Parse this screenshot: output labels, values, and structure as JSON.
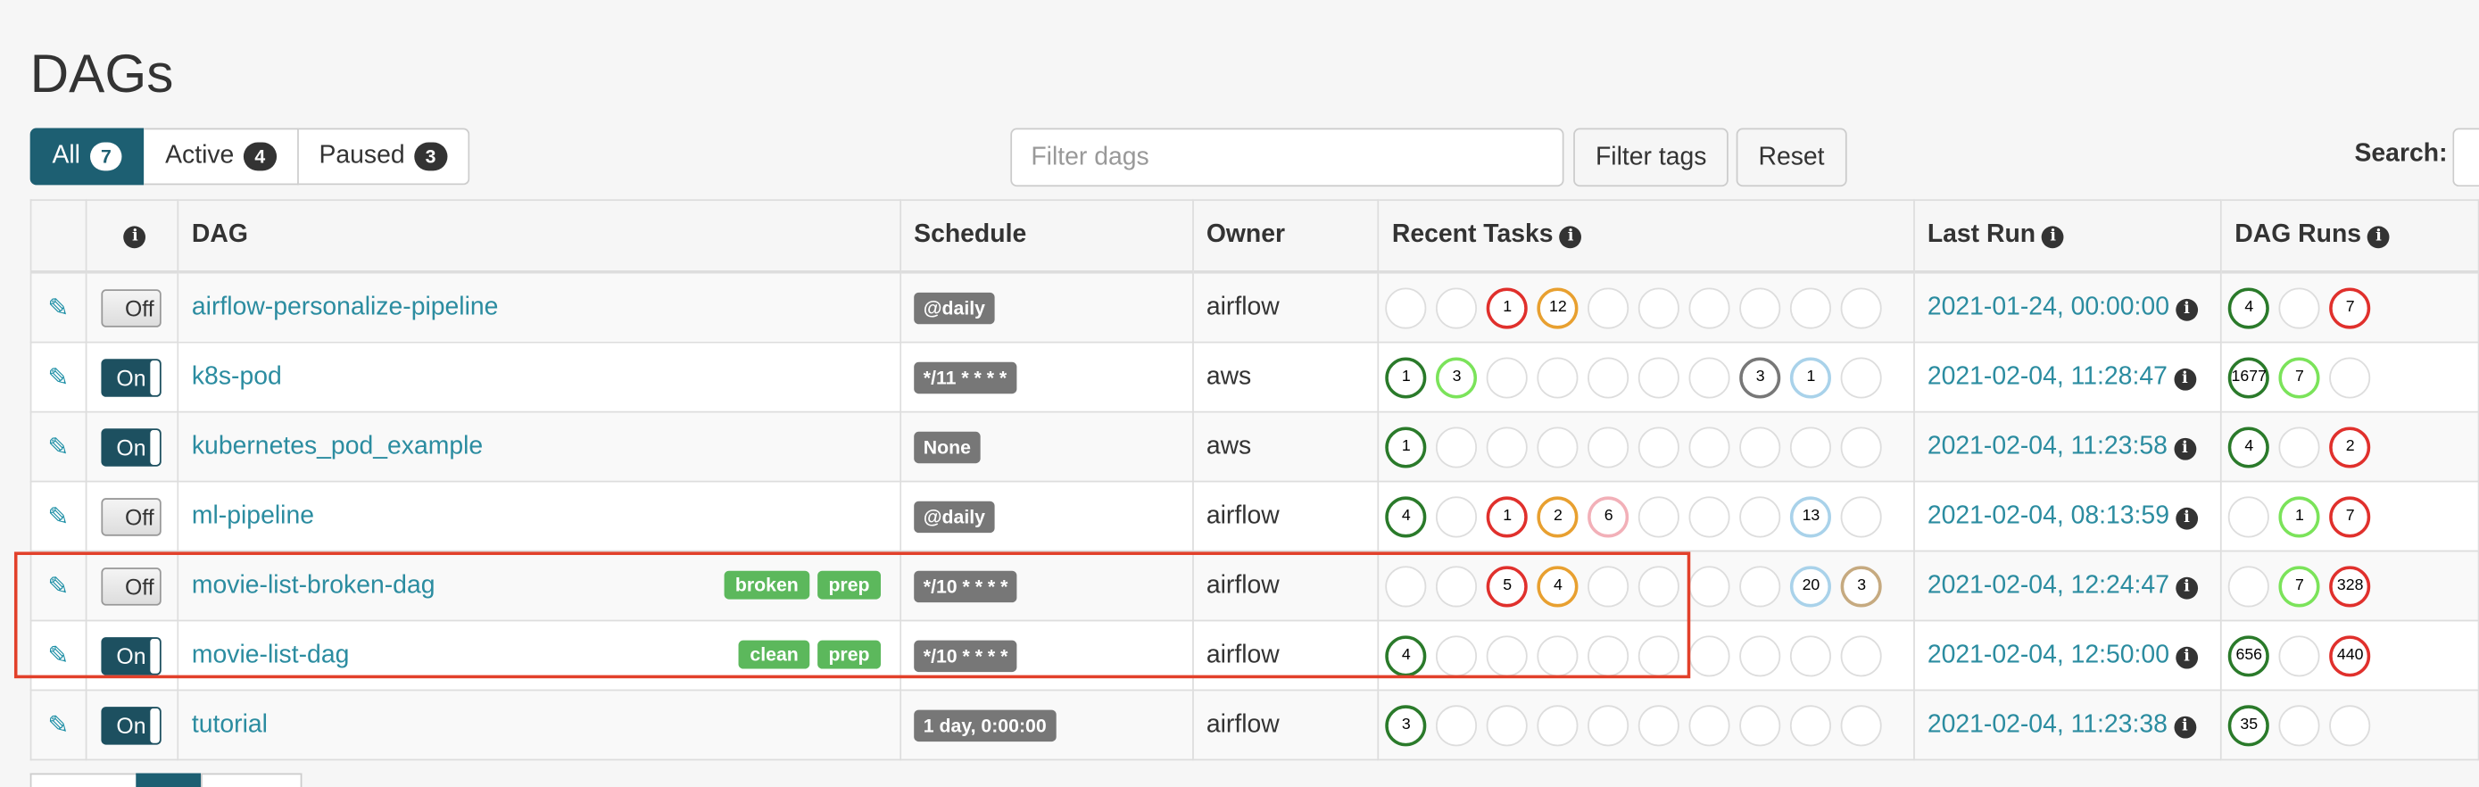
{
  "page": {
    "title": "DAGs"
  },
  "filters": {
    "all": {
      "label": "All",
      "count": "7"
    },
    "active": {
      "label": "Active",
      "count": "4"
    },
    "paused": {
      "label": "Paused",
      "count": "3"
    },
    "search_placeholder": "Filter dags",
    "filter_tags_label": "Filter tags",
    "reset_label": "Reset",
    "search_label": "Search:"
  },
  "columns": {
    "dag": "DAG",
    "schedule": "Schedule",
    "owner": "Owner",
    "recent_tasks": "Recent Tasks",
    "last_run": "Last Run",
    "dag_runs": "DAG Runs"
  },
  "info_icon_glyph": "i",
  "edit_icon_glyph": "✎",
  "state_colors": {
    "success": "#2a7a2a",
    "failed": "#e0302c",
    "upstream_failed": "#e8a030",
    "up_for_retry": "#f2b0b8",
    "skipped": "#777777",
    "queued": "#a9d2ea",
    "running": "#7be35a",
    "removed": "#c6aa80",
    "accent": "#1d5f72",
    "link": "#2b8ca0"
  },
  "rows": [
    {
      "toggle": "Off",
      "name": "airflow-personalize-pipeline",
      "tags": [],
      "schedule": "@daily",
      "owner": "airflow",
      "recent_tasks": [
        [
          "",
          ""
        ],
        [
          "",
          ""
        ],
        [
          "f",
          "1"
        ],
        [
          "r",
          "12"
        ],
        [
          "",
          ""
        ],
        [
          "",
          ""
        ],
        [
          "",
          ""
        ],
        [
          "",
          ""
        ],
        [
          "",
          ""
        ],
        [
          "",
          ""
        ]
      ],
      "last_run": "2021-01-24, 00:00:00",
      "dag_runs": [
        [
          "s",
          "4"
        ],
        [
          "",
          ""
        ],
        [
          "f",
          "7"
        ]
      ]
    },
    {
      "toggle": "On",
      "name": "k8s-pod",
      "tags": [],
      "schedule": "*/11 * * * *",
      "owner": "aws",
      "recent_tasks": [
        [
          "s",
          "1"
        ],
        [
          "l",
          "3"
        ],
        [
          "",
          ""
        ],
        [
          "",
          ""
        ],
        [
          "",
          ""
        ],
        [
          "",
          ""
        ],
        [
          "",
          ""
        ],
        [
          "k",
          "3"
        ],
        [
          "q",
          "1"
        ],
        [
          "",
          ""
        ]
      ],
      "last_run": "2021-02-04, 11:28:47",
      "dag_runs": [
        [
          "s",
          "1677"
        ],
        [
          "l",
          "7"
        ],
        [
          "",
          ""
        ]
      ]
    },
    {
      "toggle": "On",
      "name": "kubernetes_pod_example",
      "tags": [],
      "schedule": "None",
      "owner": "aws",
      "recent_tasks": [
        [
          "s",
          "1"
        ],
        [
          "",
          ""
        ],
        [
          "",
          ""
        ],
        [
          "",
          ""
        ],
        [
          "",
          ""
        ],
        [
          "",
          ""
        ],
        [
          "",
          ""
        ],
        [
          "",
          ""
        ],
        [
          "",
          ""
        ],
        [
          "",
          ""
        ]
      ],
      "last_run": "2021-02-04, 11:23:58",
      "dag_runs": [
        [
          "s",
          "4"
        ],
        [
          "",
          ""
        ],
        [
          "f",
          "2"
        ]
      ]
    },
    {
      "toggle": "Off",
      "name": "ml-pipeline",
      "tags": [],
      "schedule": "@daily",
      "owner": "airflow",
      "recent_tasks": [
        [
          "s",
          "4"
        ],
        [
          "",
          ""
        ],
        [
          "f",
          "1"
        ],
        [
          "r",
          "2"
        ],
        [
          "u",
          "6"
        ],
        [
          "",
          ""
        ],
        [
          "",
          ""
        ],
        [
          "",
          ""
        ],
        [
          "q",
          "13"
        ],
        [
          "",
          ""
        ]
      ],
      "last_run": "2021-02-04, 08:13:59",
      "dag_runs": [
        [
          "",
          ""
        ],
        [
          "l",
          "1"
        ],
        [
          "f",
          "7"
        ]
      ]
    },
    {
      "toggle": "Off",
      "name": "movie-list-broken-dag",
      "tags": [
        "broken",
        "prep"
      ],
      "schedule": "*/10 * * * *",
      "owner": "airflow",
      "recent_tasks": [
        [
          "",
          ""
        ],
        [
          "",
          ""
        ],
        [
          "f",
          "5"
        ],
        [
          "r",
          "4"
        ],
        [
          "",
          ""
        ],
        [
          "",
          ""
        ],
        [
          "",
          ""
        ],
        [
          "",
          ""
        ],
        [
          "q",
          "20"
        ],
        [
          "d",
          "3"
        ]
      ],
      "last_run": "2021-02-04, 12:24:47",
      "dag_runs": [
        [
          "",
          ""
        ],
        [
          "l",
          "7"
        ],
        [
          "f",
          "328"
        ]
      ]
    },
    {
      "toggle": "On",
      "name": "movie-list-dag",
      "tags": [
        "clean",
        "prep"
      ],
      "schedule": "*/10 * * * *",
      "owner": "airflow",
      "recent_tasks": [
        [
          "s",
          "4"
        ],
        [
          "",
          ""
        ],
        [
          "",
          ""
        ],
        [
          "",
          ""
        ],
        [
          "",
          ""
        ],
        [
          "",
          ""
        ],
        [
          "",
          ""
        ],
        [
          "",
          ""
        ],
        [
          "",
          ""
        ],
        [
          "",
          ""
        ]
      ],
      "last_run": "2021-02-04, 12:50:00",
      "dag_runs": [
        [
          "s",
          "656"
        ],
        [
          "",
          ""
        ],
        [
          "f",
          "440"
        ]
      ]
    },
    {
      "toggle": "On",
      "name": "tutorial",
      "tags": [],
      "schedule": "1 day, 0:00:00",
      "owner": "airflow",
      "recent_tasks": [
        [
          "s",
          "3"
        ],
        [
          "",
          ""
        ],
        [
          "",
          ""
        ],
        [
          "",
          ""
        ],
        [
          "",
          ""
        ],
        [
          "",
          ""
        ],
        [
          "",
          ""
        ],
        [
          "",
          ""
        ],
        [
          "",
          ""
        ],
        [
          "",
          ""
        ]
      ],
      "last_run": "2021-02-04, 11:23:38",
      "dag_runs": [
        [
          "s",
          "35"
        ],
        [
          "",
          ""
        ],
        [
          "",
          ""
        ]
      ]
    }
  ]
}
